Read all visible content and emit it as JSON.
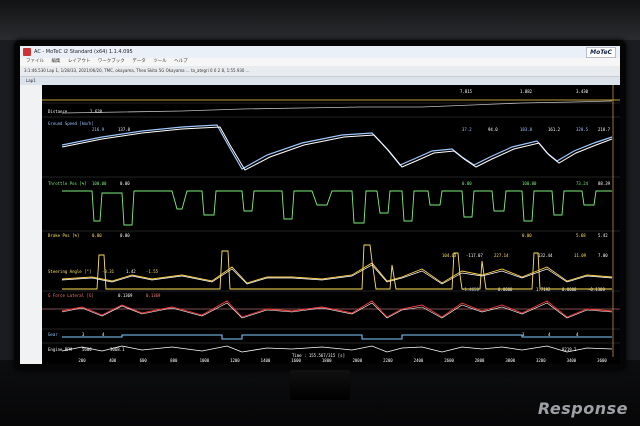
{
  "window": {
    "title": "AC - MoTeC i2 Standard (x64) 1.1.4.095",
    "brand": "MoTeC"
  },
  "menubar": [
    "ファイル",
    "編集",
    "レイアウト",
    "ワークブック",
    "データ",
    "ツール",
    "ヘルプ"
  ],
  "toolbar": {
    "text": "3:1:46.530 Lap 1, 1/28/33, 2021/06/20, TMC, okayama, Theo Skita 5G Okayama ... ta_ategri 0 0 2 8, 1:55.930 ..."
  },
  "tab": {
    "label": "Lap1"
  },
  "channels": [
    {
      "name": "Distance",
      "values": [
        "2.620",
        "7.815",
        "1.882",
        "3.430"
      ]
    },
    {
      "name": "Ground Speed [km/h]",
      "values": [
        "216.9",
        "137.8",
        "37.2",
        "94.0",
        "183.8",
        "161.2",
        "328.5",
        "218.7"
      ]
    },
    {
      "name": "Throttle Pos [%]",
      "values": [
        "100.00",
        "0.00",
        "0.00",
        "100.00",
        "73.24",
        "88.39"
      ]
    },
    {
      "name": "Brake Pos [%]",
      "values": [
        "0.00",
        "0.00",
        "0.00",
        "5.68",
        "5.42"
      ]
    },
    {
      "name": "Steering Angle [°]",
      "values": [
        "-0.31",
        "1.42",
        "-1.55",
        "104.63",
        "-117.07",
        "227.14",
        "132.44",
        "11.09",
        "7.00"
      ]
    },
    {
      "name": "G Force Lateral [G]",
      "values": [
        "0.1369",
        "0.1369",
        "-1.4650",
        "0.0000",
        "1.7192",
        "0.0000",
        "-0.1308"
      ]
    },
    {
      "name": "Gear",
      "values": [
        "3",
        "4",
        "3",
        "4",
        "4"
      ]
    },
    {
      "name": "Engine RPM",
      "values": [
        "5600",
        "3068.1",
        "8219.2"
      ]
    }
  ],
  "x_axis": {
    "ticks": [
      "200",
      "400",
      "600",
      "800",
      "1000",
      "1200",
      "1400",
      "1600",
      "1800",
      "2000",
      "2200",
      "2400",
      "2600",
      "2800",
      "3000",
      "3200",
      "3400",
      "3600"
    ],
    "readout": "Time : 155.567/315 [s]"
  },
  "watermark": "Response",
  "colors": {
    "plot_bg": "#000000",
    "speed_a": "#9ec7ff",
    "speed_b": "#ffffff",
    "throttle": "#7df07d",
    "brake": "#ffe25a",
    "steering": "#ffd24a",
    "glat": "#ff3b3b",
    "gear": "#7fd0ff",
    "rpm": "#ffffff"
  }
}
